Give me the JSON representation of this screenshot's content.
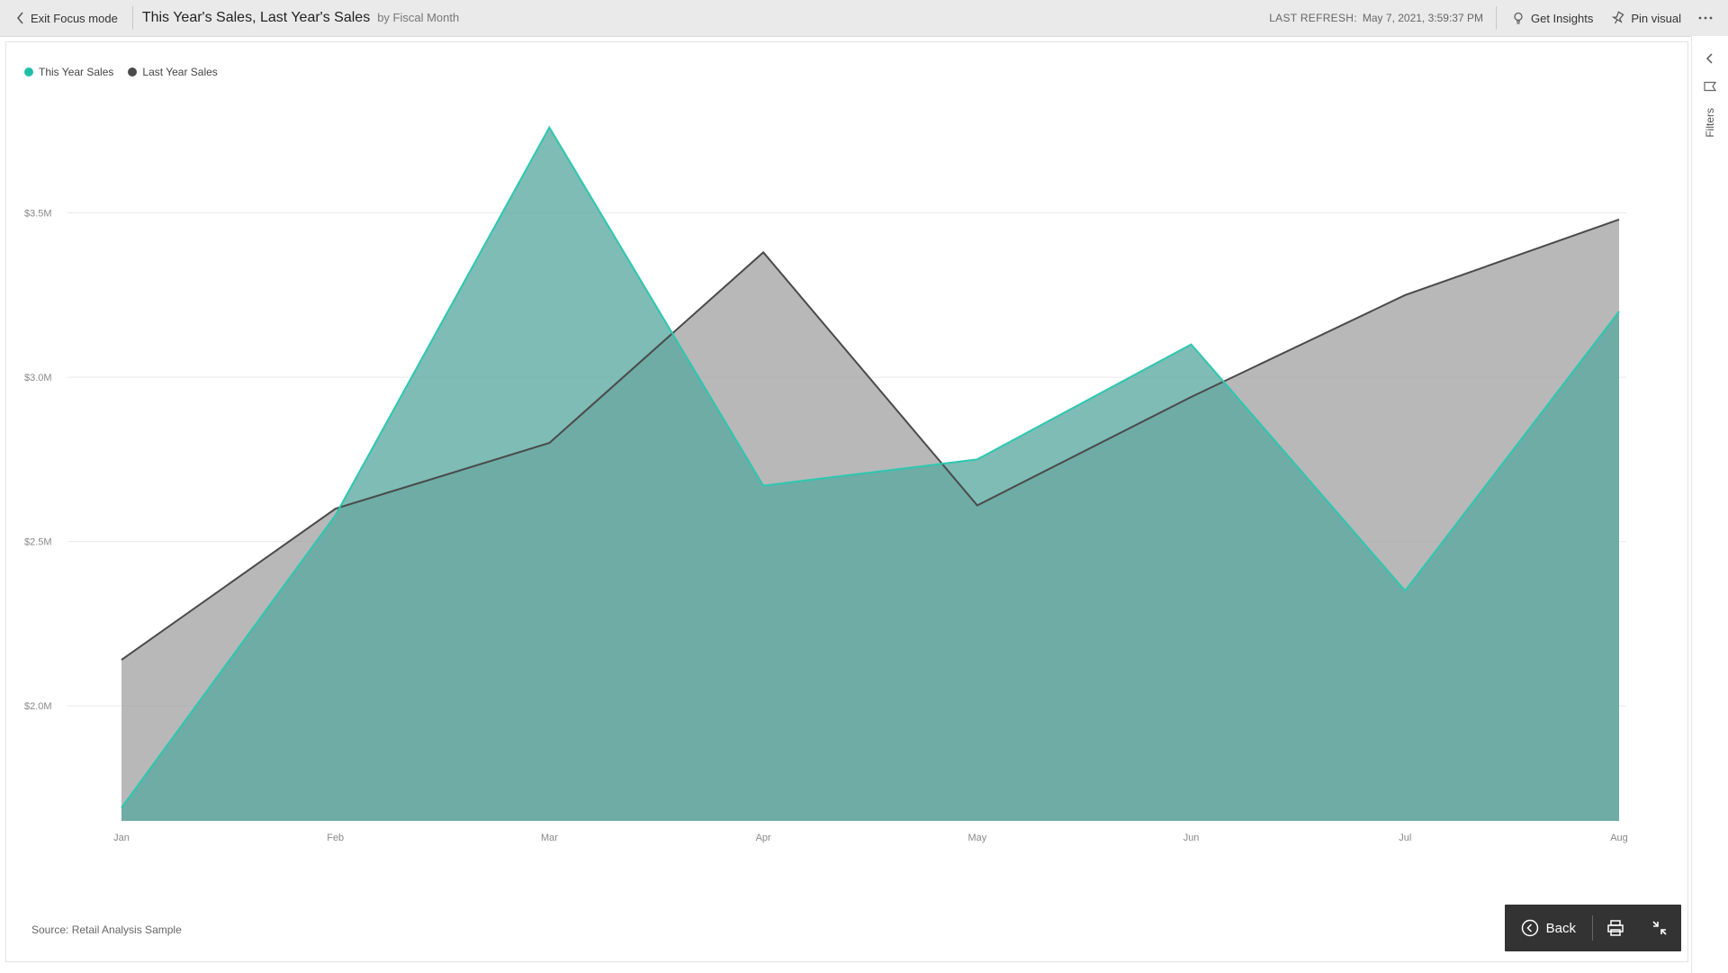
{
  "topbar": {
    "exit_focus": "Exit Focus mode",
    "title": "This Year's Sales, Last Year's Sales",
    "subtitle": "by Fiscal Month",
    "refresh_label": "LAST REFRESH:",
    "refresh_value": "May 7, 2021, 3:59:37 PM",
    "get_insights": "Get Insights",
    "pin_visual": "Pin visual"
  },
  "legend": {
    "series1": "This Year Sales",
    "series2": "Last Year Sales"
  },
  "axes": {
    "y_ticks": [
      "$2.0M",
      "$2.5M",
      "$3.0M",
      "$3.5M"
    ],
    "x_ticks": [
      "Jan",
      "Feb",
      "Mar",
      "Apr",
      "May",
      "Jun",
      "Jul",
      "Aug"
    ]
  },
  "footer": {
    "source": "Source: Retail Analysis Sample"
  },
  "side": {
    "filters": "Filters"
  },
  "bottombar": {
    "back": "Back"
  },
  "colors": {
    "this_year_stroke": "#2ec7b0",
    "this_year_fill": "#5aa9a0",
    "last_year_stroke": "#4a4a4a",
    "last_year_fill": "#9c9c9c"
  },
  "chart_data": {
    "type": "area",
    "xlabel": "",
    "ylabel": "",
    "title": "This Year's Sales, Last Year's Sales by Fiscal Month",
    "ylim": [
      1650000,
      3800000
    ],
    "categories": [
      "Jan",
      "Feb",
      "Mar",
      "Apr",
      "May",
      "Jun",
      "Jul",
      "Aug"
    ],
    "series": [
      {
        "name": "This Year Sales",
        "color": "#2ec7b0",
        "values": [
          1690000,
          2580000,
          3760000,
          2670000,
          2750000,
          3100000,
          2350000,
          3200000
        ]
      },
      {
        "name": "Last Year Sales",
        "color": "#4a4a4a",
        "values": [
          2140000,
          2600000,
          2800000,
          3380000,
          2610000,
          2940000,
          3250000,
          3480000
        ]
      }
    ]
  }
}
